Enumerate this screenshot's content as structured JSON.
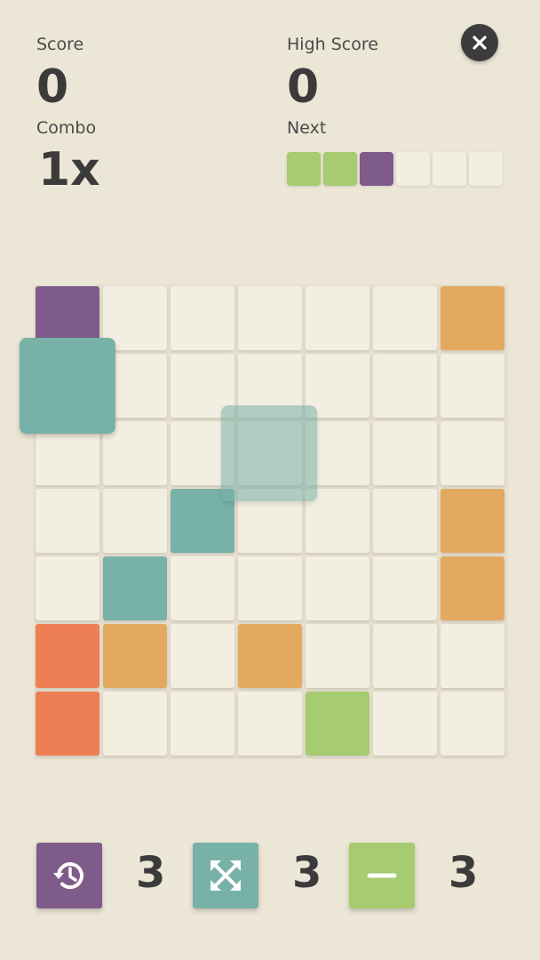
{
  "header": {
    "score_label": "Score",
    "score_value": "0",
    "high_score_label": "High Score",
    "high_score_value": "0",
    "combo_label": "Combo",
    "combo_value": "1x",
    "next_label": "Next"
  },
  "colors": {
    "empty": "#f3eee2",
    "purple": "#7f5b8b",
    "teal": "#78b1a7",
    "orange": "#e3a95e",
    "red": "#ee7e53",
    "green": "#a6cb70",
    "dark": "#3c3c3c"
  },
  "next_queue": [
    "green",
    "green",
    "purple",
    "empty",
    "empty",
    "empty"
  ],
  "board": {
    "size": 7,
    "grid": [
      [
        "purple",
        "empty",
        "empty",
        "empty",
        "empty",
        "empty",
        "orange"
      ],
      [
        "empty",
        "empty",
        "empty",
        "empty",
        "empty",
        "empty",
        "empty"
      ],
      [
        "empty",
        "empty",
        "empty",
        "empty",
        "empty",
        "empty",
        "empty"
      ],
      [
        "empty",
        "empty",
        "teal",
        "empty",
        "empty",
        "empty",
        "orange"
      ],
      [
        "empty",
        "teal",
        "empty",
        "empty",
        "empty",
        "empty",
        "orange"
      ],
      [
        "red",
        "orange",
        "empty",
        "orange",
        "empty",
        "empty",
        "empty"
      ],
      [
        "red",
        "empty",
        "empty",
        "empty",
        "green",
        "empty",
        "empty"
      ]
    ]
  },
  "dragging_piece": {
    "color": "teal"
  },
  "drop_preview": {
    "color": "teal"
  },
  "powerups": [
    {
      "name": "undo",
      "icon": "history-icon",
      "color": "purple",
      "count": "3"
    },
    {
      "name": "shuffle",
      "icon": "expand-arrows-icon",
      "color": "teal",
      "count": "3"
    },
    {
      "name": "remove",
      "icon": "minus-icon",
      "color": "green",
      "count": "3"
    }
  ]
}
